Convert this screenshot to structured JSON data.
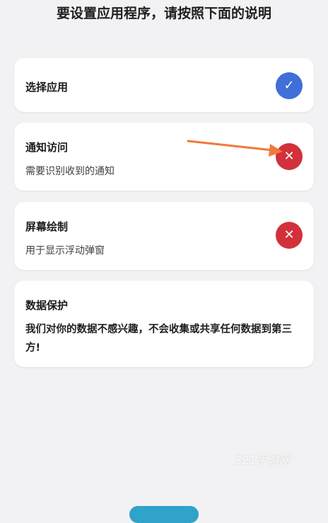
{
  "page": {
    "title": "要设置应用程序，请按照下面的说明"
  },
  "items": [
    {
      "title": "选择应用",
      "subtitle": "",
      "status": "granted",
      "status_icon": "check-icon"
    },
    {
      "title": "通知访问",
      "subtitle": "需要识别收到的通知",
      "status": "denied",
      "status_icon": "close-icon"
    },
    {
      "title": "屏幕绘制",
      "subtitle": "用于显示浮动弹窗",
      "status": "denied",
      "status_icon": "close-icon"
    }
  ],
  "privacy": {
    "title": "数据保护",
    "body": "我们对你的数据不感兴趣，不会收集或共享任何数据到第三方!"
  },
  "watermark": "321手游网",
  "colors": {
    "background": "#f2f2f4",
    "granted": "#3f6fd8",
    "denied": "#d2303a",
    "arrow": "#f07a3a",
    "bottom_button": "#2fa3c9"
  }
}
